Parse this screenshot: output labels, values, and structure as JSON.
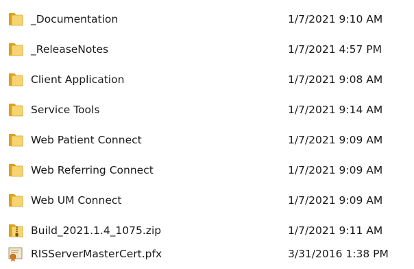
{
  "files": [
    {
      "name": "_Documentation",
      "date_modified": "1/7/2021 9:10 AM",
      "icon": "folder-icon"
    },
    {
      "name": "_ReleaseNotes",
      "date_modified": "1/7/2021 4:57 PM",
      "icon": "folder-icon"
    },
    {
      "name": "Client Application",
      "date_modified": "1/7/2021 9:08 AM",
      "icon": "folder-icon"
    },
    {
      "name": "Service Tools",
      "date_modified": "1/7/2021 9:14 AM",
      "icon": "folder-icon"
    },
    {
      "name": "Web Patient Connect",
      "date_modified": "1/7/2021 9:09 AM",
      "icon": "folder-icon"
    },
    {
      "name": "Web Referring Connect",
      "date_modified": "1/7/2021 9:09 AM",
      "icon": "folder-icon"
    },
    {
      "name": "Web UM Connect",
      "date_modified": "1/7/2021 9:09 AM",
      "icon": "folder-icon"
    },
    {
      "name": "Build_2021.1.4_1075.zip",
      "date_modified": "1/7/2021 9:11 AM",
      "icon": "zip-folder-icon"
    },
    {
      "name": "RISServerMasterCert.pfx",
      "date_modified": "3/31/2016 1:38 PM",
      "icon": "certificate-icon"
    }
  ],
  "colors": {
    "folder_back": "#d9a21b",
    "folder_front": "#f7d472",
    "zip_zipper": "#9a7a30",
    "cert_body": "#f2e7c8",
    "cert_seal": "#d4791c"
  }
}
